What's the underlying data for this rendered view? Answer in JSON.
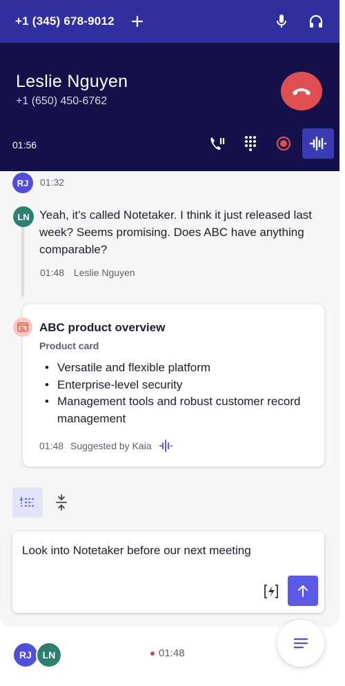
{
  "topbar": {
    "phone_number": "+1 (345) 678-9012",
    "icons": [
      "plus-icon",
      "microphone-icon",
      "headphones-icon"
    ]
  },
  "call": {
    "caller_name": "Leslie Nguyen",
    "caller_number": "+1 (650) 450-6762",
    "timer": "01:56",
    "hangup_color": "#e05050",
    "controls": [
      "transfer-call-icon",
      "dialpad-icon",
      "record-icon",
      "waveform-icon"
    ]
  },
  "transcript": {
    "prev_entry": {
      "avatar": "RJ",
      "time": "01:32"
    },
    "message": {
      "avatar": "LN",
      "text": "Yeah, it’s called Notetaker. I think it just released last week? Seems promising. Does ABC have anything comparable?",
      "time": "01:48",
      "speaker": "Leslie Nguyen"
    }
  },
  "card": {
    "title": "ABC product overview",
    "subtitle": "Product card",
    "items": [
      "Versatile and flexible platform",
      "Enterprise-level security",
      "Management tools and robust customer record management"
    ],
    "time": "01:48",
    "suggested_by": "Suggested by Kaia"
  },
  "composer": {
    "value": "Look into Notetaker before our next meeting"
  },
  "bottombar": {
    "avatars": [
      "RJ",
      "LN"
    ],
    "timer": "01:48"
  },
  "colors": {
    "topbar": "#2f2f9f",
    "call_panel": "#15114a",
    "accent": "#5a5ae6",
    "rj_avatar": "#4f4fdb",
    "ln_avatar": "#2e7e72"
  }
}
